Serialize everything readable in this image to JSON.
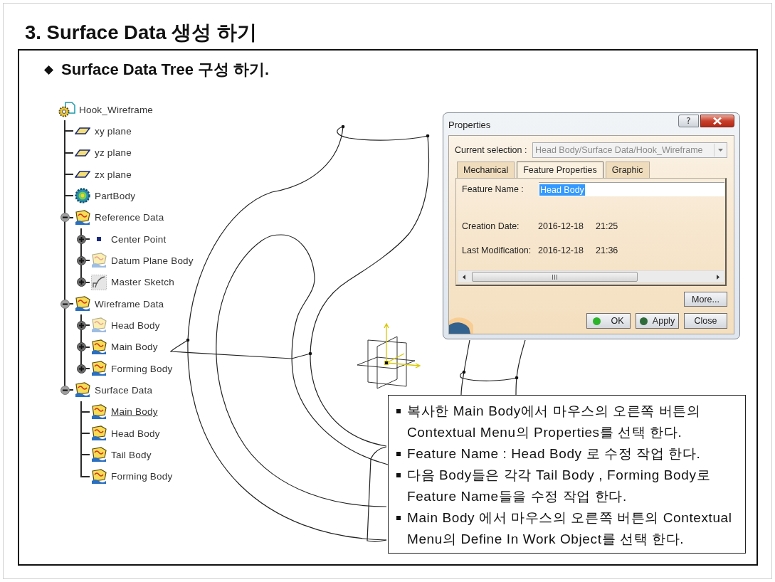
{
  "title": "3. Surface Data 생성 하기",
  "subtitle": "Surface Data Tree 구성 하기.",
  "tree": {
    "label": "Hook_Wireframe",
    "kind": "part",
    "current": false,
    "children": [
      {
        "label": "xy plane",
        "kind": "plane",
        "current": false
      },
      {
        "label": "yz plane",
        "kind": "plane",
        "current": false
      },
      {
        "label": "zx plane",
        "kind": "plane",
        "current": false
      },
      {
        "label": "PartBody",
        "kind": "body",
        "current": false
      },
      {
        "label": "Reference Data",
        "kind": "set",
        "current": false,
        "expanded": true,
        "children": [
          {
            "label": "Center Point",
            "kind": "point",
            "current": false,
            "expanded": false
          },
          {
            "label": "Datum Plane Body",
            "kind": "hiddenset",
            "current": false,
            "expanded": false
          },
          {
            "label": "Master Sketch",
            "kind": "sketch",
            "current": false,
            "expanded": false
          }
        ]
      },
      {
        "label": "Wireframe Data",
        "kind": "set",
        "current": false,
        "expanded": true,
        "children": [
          {
            "label": "Head Body",
            "kind": "hiddenset",
            "current": false,
            "expanded": false
          },
          {
            "label": "Main Body",
            "kind": "set",
            "current": false,
            "expanded": false
          },
          {
            "label": "Forming Body",
            "kind": "set",
            "current": false,
            "expanded": false
          }
        ]
      },
      {
        "label": "Surface Data",
        "kind": "set",
        "current": false,
        "expanded": true,
        "children": [
          {
            "label": "Main Body",
            "kind": "set",
            "current": true
          },
          {
            "label": "Head Body",
            "kind": "set",
            "current": false
          },
          {
            "label": "Tail Body",
            "kind": "set",
            "current": false
          },
          {
            "label": "Forming Body",
            "kind": "set",
            "current": false
          }
        ]
      }
    ]
  },
  "dialog": {
    "title": "Properties",
    "help_button": "?",
    "current_selection": {
      "label": "Current selection :",
      "value": "Head Body/Surface Data/Hook_Wireframe",
      "disabled": true
    },
    "tabs": [
      {
        "label": "Mechanical",
        "selected": false
      },
      {
        "label": "Feature Properties",
        "selected": true
      },
      {
        "label": "Graphic",
        "selected": false
      }
    ],
    "feature_name": {
      "label": "Feature Name :",
      "value": "Head Body",
      "highlighted": true
    },
    "dates": [
      {
        "label": "Creation Date:",
        "date": "2016-12-18",
        "time": "21:25"
      },
      {
        "label": "Last Modification:",
        "date": "2016-12-18",
        "time": "21:36"
      }
    ],
    "more_button": "More...",
    "buttons": [
      {
        "label": "OK",
        "kind": "ok",
        "color": "#2bb32b"
      },
      {
        "label": "Apply",
        "kind": "apply",
        "color": "#2f6b3a"
      },
      {
        "label": "Close",
        "kind": "close"
      }
    ]
  },
  "notes": [
    "복사한 Main Body에서 마우스의 오른쪽 버튼의 Contextual Menu의 Properties를 선택 한다.",
    "Feature Name : Head Body 로 수정 작업 한다.",
    "다음 Body들은 각각 Tail Body , Forming Body로 Feature Name들을 수정 작업 한다.",
    "Main Body 에서 마우스의 오른쪽 버튼의 Contextual Menu의 Define In Work Object를 선택 한다."
  ]
}
